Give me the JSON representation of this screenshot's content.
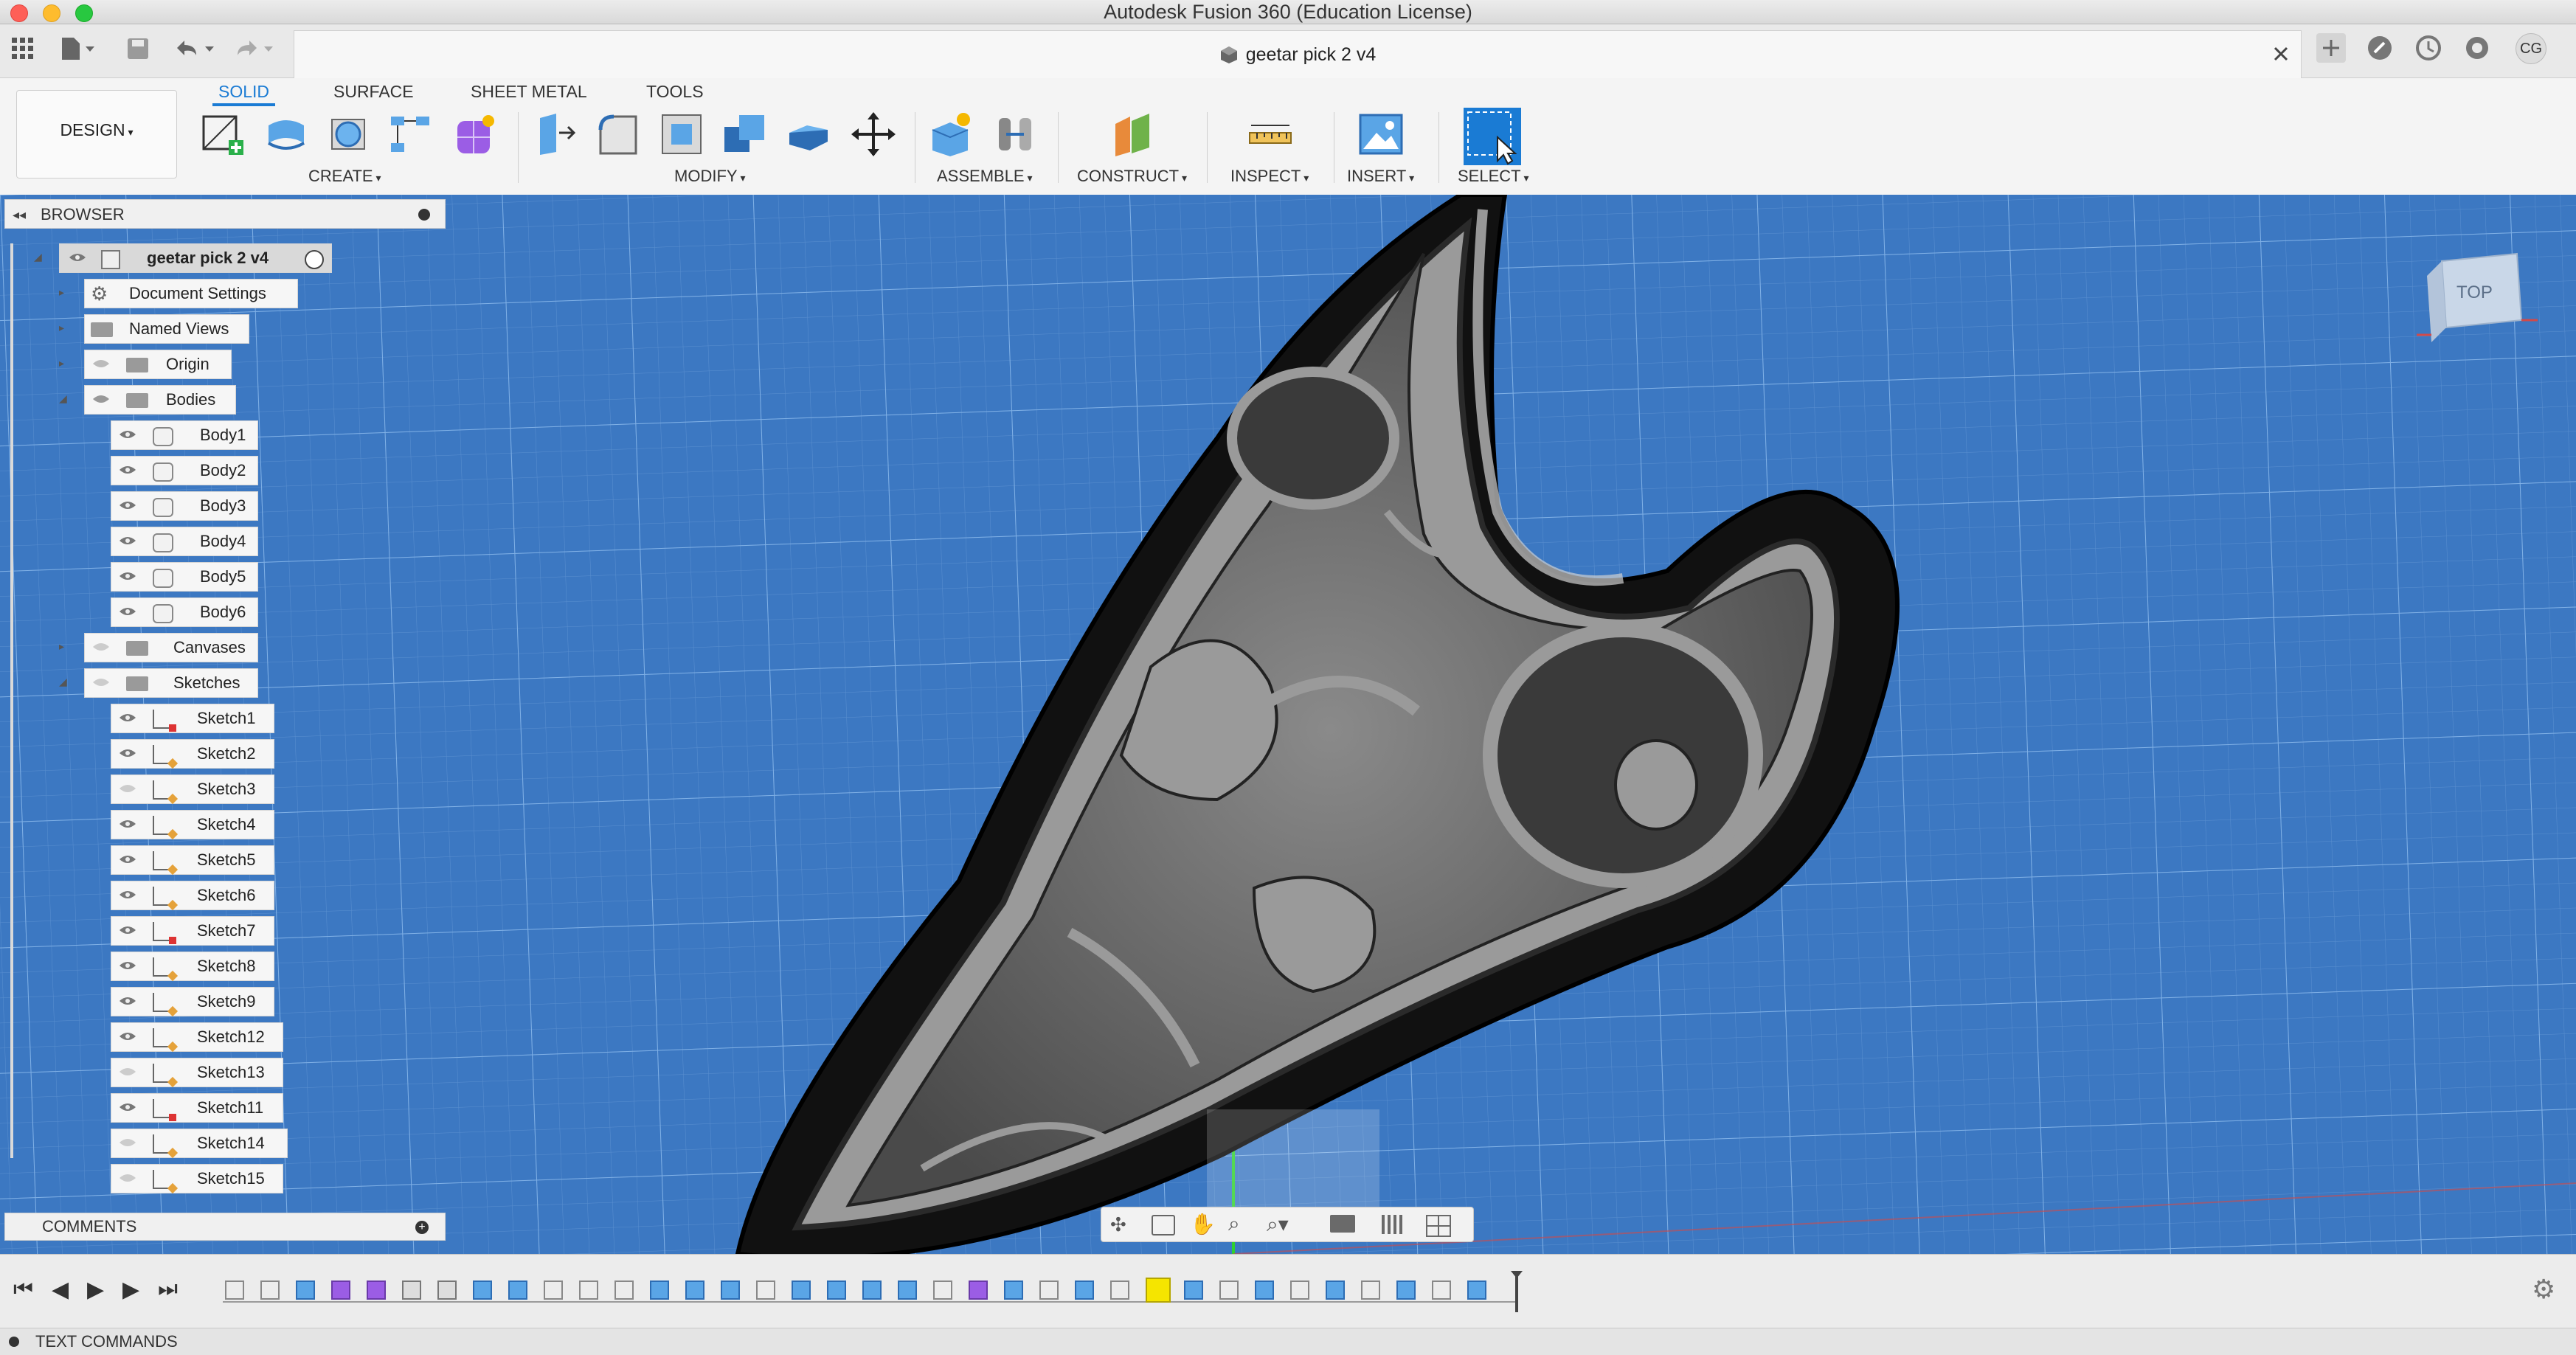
{
  "window": {
    "title": "Autodesk Fusion 360 (Education License)",
    "document_tab": "geetar pick 2 v4",
    "user_initials": "CG"
  },
  "ribbon": {
    "workspace": "DESIGN",
    "tabs": [
      "SOLID",
      "SURFACE",
      "SHEET METAL",
      "TOOLS"
    ],
    "active_tab": "SOLID",
    "groups": [
      "CREATE",
      "MODIFY",
      "ASSEMBLE",
      "CONSTRUCT",
      "INSPECT",
      "INSERT",
      "SELECT"
    ]
  },
  "browser": {
    "title": "BROWSER",
    "root": "geetar pick 2 v4",
    "folders": {
      "document_settings": "Document Settings",
      "named_views": "Named Views",
      "origin": "Origin",
      "bodies": "Bodies",
      "canvases": "Canvases",
      "sketches": "Sketches"
    },
    "bodies": [
      "Body1",
      "Body2",
      "Body3",
      "Body4",
      "Body5",
      "Body6"
    ],
    "sketches": [
      "Sketch1",
      "Sketch2",
      "Sketch3",
      "Sketch4",
      "Sketch5",
      "Sketch6",
      "Sketch7",
      "Sketch8",
      "Sketch9",
      "Sketch12",
      "Sketch13",
      "Sketch11",
      "Sketch14",
      "Sketch15"
    ]
  },
  "comments": {
    "label": "COMMENTS"
  },
  "viewcube": {
    "face": "TOP"
  },
  "bottom": {
    "text_commands": "TEXT COMMANDS"
  },
  "colors": {
    "accent": "#1a7bd4",
    "grid_background": "#3c78c2",
    "model_gray": "#8a8a8a"
  }
}
